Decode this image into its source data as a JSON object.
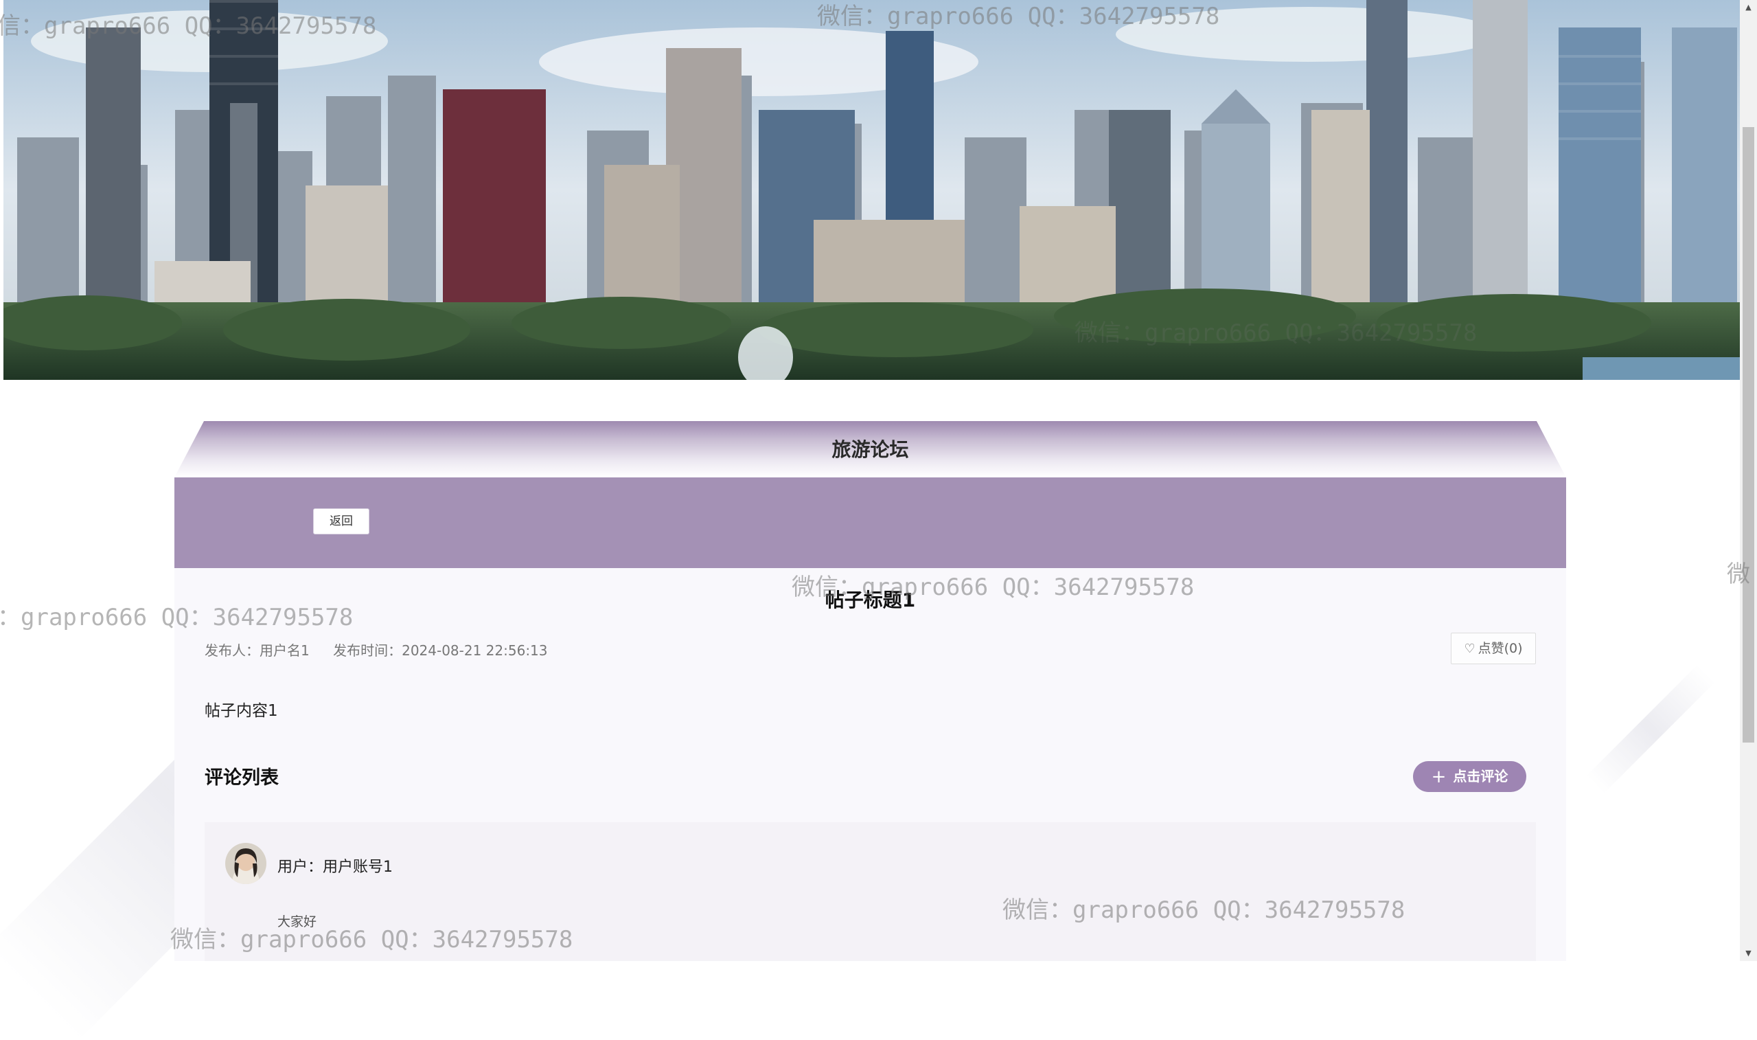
{
  "forum": {
    "title": "旅游论坛",
    "back_label": "返回"
  },
  "post": {
    "title": "帖子标题1",
    "author": "发布人：用户名1",
    "published": "发布时间：2024-08-21 22:56:13",
    "like_label": "点赞(0)",
    "body": "帖子内容1"
  },
  "comments": {
    "heading": "评论列表",
    "add_label": "点击评论",
    "items": [
      {
        "user": "用户：用户账号1",
        "text": "大家好"
      }
    ]
  },
  "watermarks": [
    "信：grapro666 QQ：3642795578",
    "微信：grapro666 QQ：3642795578",
    "微信：grapro666 QQ：3642795578",
    "微信：grapro666 QQ：3642795578",
    "：grapro666 QQ：3642795578",
    "微",
    "微信：grapro666 QQ：3642795578",
    "微信：grapro666 QQ：3642795578"
  ],
  "colors": {
    "accent_purple": "#a491b5",
    "button_purple": "#9e85b3"
  },
  "icons": {
    "like": "heart-outline-icon",
    "add": "plus-icon"
  }
}
